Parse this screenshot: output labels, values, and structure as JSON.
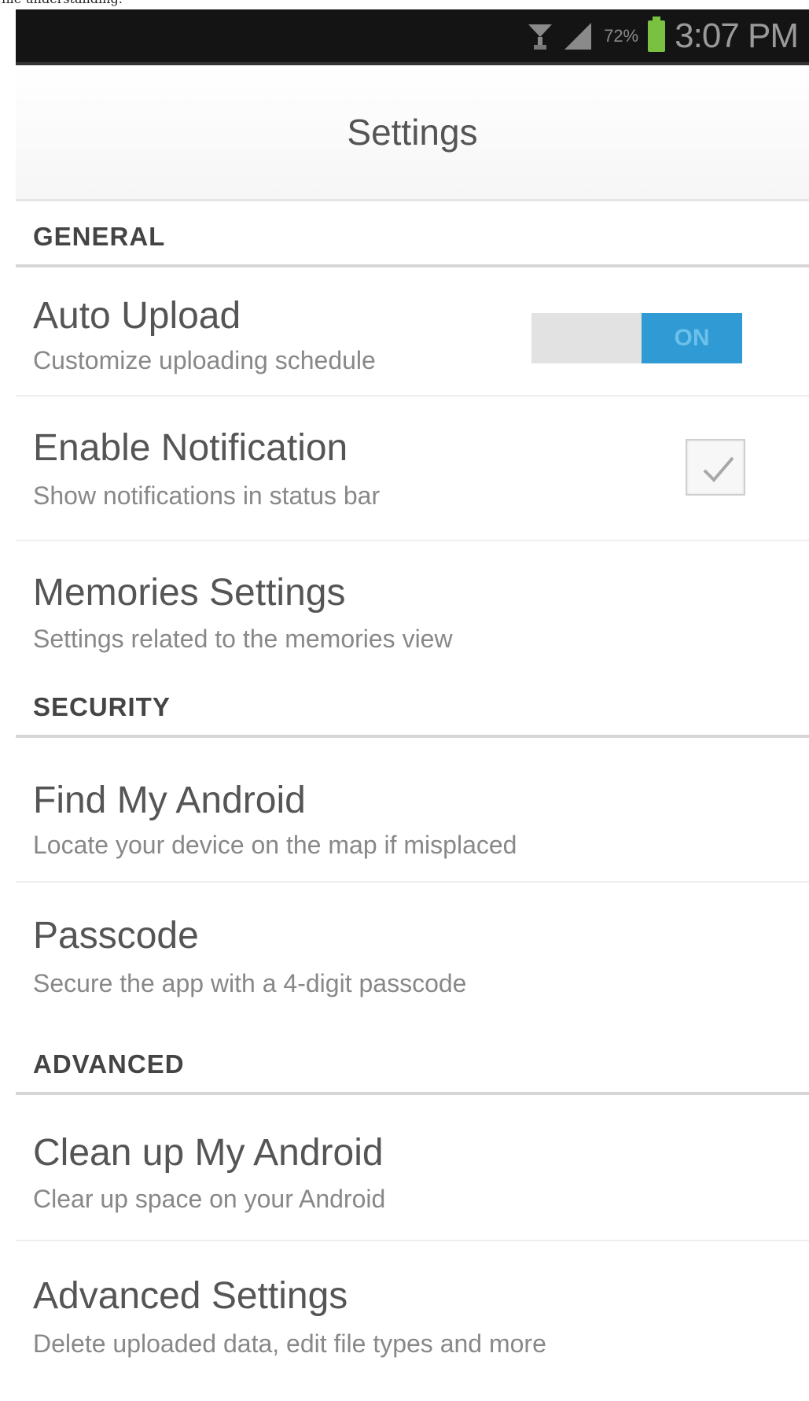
{
  "caption": "file understanding.",
  "status_bar": {
    "battery_percent": "72%",
    "time": "3:07 PM"
  },
  "header": {
    "title": "Settings"
  },
  "sections": {
    "general": {
      "label": "GENERAL",
      "auto_upload": {
        "title": "Auto Upload",
        "subtitle": "Customize uploading schedule",
        "toggle_label": "ON"
      },
      "enable_notification": {
        "title": "Enable Notification",
        "subtitle": "Show notifications in status bar",
        "checked": true
      },
      "memories_settings": {
        "title": "Memories Settings",
        "subtitle": "Settings related to the memories view"
      }
    },
    "security": {
      "label": "SECURITY",
      "find_my_android": {
        "title": "Find My Android",
        "subtitle": "Locate your device on the map if misplaced"
      },
      "passcode": {
        "title": "Passcode",
        "subtitle": "Secure the app with a 4-digit passcode"
      }
    },
    "advanced": {
      "label": "ADVANCED",
      "clean_up": {
        "title": "Clean up My Android",
        "subtitle": "Clear up space on your Android"
      },
      "advanced_settings": {
        "title": "Advanced Settings",
        "subtitle": "Delete uploaded data, edit file types and more"
      }
    }
  },
  "colors": {
    "toggle_on": "#2f9ad4",
    "battery": "#7ac142",
    "status_bar_bg": "#141414"
  }
}
